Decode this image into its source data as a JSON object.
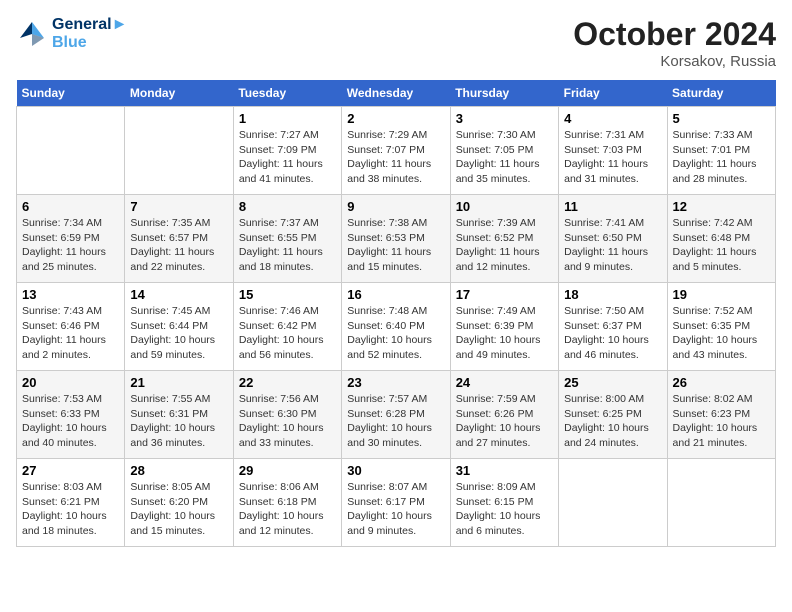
{
  "header": {
    "logo_line1": "General",
    "logo_line2": "Blue",
    "month": "October 2024",
    "location": "Korsakov, Russia"
  },
  "days_of_week": [
    "Sunday",
    "Monday",
    "Tuesday",
    "Wednesday",
    "Thursday",
    "Friday",
    "Saturday"
  ],
  "weeks": [
    [
      {
        "day": "",
        "info": ""
      },
      {
        "day": "",
        "info": ""
      },
      {
        "day": "1",
        "info": "Sunrise: 7:27 AM\nSunset: 7:09 PM\nDaylight: 11 hours and 41 minutes."
      },
      {
        "day": "2",
        "info": "Sunrise: 7:29 AM\nSunset: 7:07 PM\nDaylight: 11 hours and 38 minutes."
      },
      {
        "day": "3",
        "info": "Sunrise: 7:30 AM\nSunset: 7:05 PM\nDaylight: 11 hours and 35 minutes."
      },
      {
        "day": "4",
        "info": "Sunrise: 7:31 AM\nSunset: 7:03 PM\nDaylight: 11 hours and 31 minutes."
      },
      {
        "day": "5",
        "info": "Sunrise: 7:33 AM\nSunset: 7:01 PM\nDaylight: 11 hours and 28 minutes."
      }
    ],
    [
      {
        "day": "6",
        "info": "Sunrise: 7:34 AM\nSunset: 6:59 PM\nDaylight: 11 hours and 25 minutes."
      },
      {
        "day": "7",
        "info": "Sunrise: 7:35 AM\nSunset: 6:57 PM\nDaylight: 11 hours and 22 minutes."
      },
      {
        "day": "8",
        "info": "Sunrise: 7:37 AM\nSunset: 6:55 PM\nDaylight: 11 hours and 18 minutes."
      },
      {
        "day": "9",
        "info": "Sunrise: 7:38 AM\nSunset: 6:53 PM\nDaylight: 11 hours and 15 minutes."
      },
      {
        "day": "10",
        "info": "Sunrise: 7:39 AM\nSunset: 6:52 PM\nDaylight: 11 hours and 12 minutes."
      },
      {
        "day": "11",
        "info": "Sunrise: 7:41 AM\nSunset: 6:50 PM\nDaylight: 11 hours and 9 minutes."
      },
      {
        "day": "12",
        "info": "Sunrise: 7:42 AM\nSunset: 6:48 PM\nDaylight: 11 hours and 5 minutes."
      }
    ],
    [
      {
        "day": "13",
        "info": "Sunrise: 7:43 AM\nSunset: 6:46 PM\nDaylight: 11 hours and 2 minutes."
      },
      {
        "day": "14",
        "info": "Sunrise: 7:45 AM\nSunset: 6:44 PM\nDaylight: 10 hours and 59 minutes."
      },
      {
        "day": "15",
        "info": "Sunrise: 7:46 AM\nSunset: 6:42 PM\nDaylight: 10 hours and 56 minutes."
      },
      {
        "day": "16",
        "info": "Sunrise: 7:48 AM\nSunset: 6:40 PM\nDaylight: 10 hours and 52 minutes."
      },
      {
        "day": "17",
        "info": "Sunrise: 7:49 AM\nSunset: 6:39 PM\nDaylight: 10 hours and 49 minutes."
      },
      {
        "day": "18",
        "info": "Sunrise: 7:50 AM\nSunset: 6:37 PM\nDaylight: 10 hours and 46 minutes."
      },
      {
        "day": "19",
        "info": "Sunrise: 7:52 AM\nSunset: 6:35 PM\nDaylight: 10 hours and 43 minutes."
      }
    ],
    [
      {
        "day": "20",
        "info": "Sunrise: 7:53 AM\nSunset: 6:33 PM\nDaylight: 10 hours and 40 minutes."
      },
      {
        "day": "21",
        "info": "Sunrise: 7:55 AM\nSunset: 6:31 PM\nDaylight: 10 hours and 36 minutes."
      },
      {
        "day": "22",
        "info": "Sunrise: 7:56 AM\nSunset: 6:30 PM\nDaylight: 10 hours and 33 minutes."
      },
      {
        "day": "23",
        "info": "Sunrise: 7:57 AM\nSunset: 6:28 PM\nDaylight: 10 hours and 30 minutes."
      },
      {
        "day": "24",
        "info": "Sunrise: 7:59 AM\nSunset: 6:26 PM\nDaylight: 10 hours and 27 minutes."
      },
      {
        "day": "25",
        "info": "Sunrise: 8:00 AM\nSunset: 6:25 PM\nDaylight: 10 hours and 24 minutes."
      },
      {
        "day": "26",
        "info": "Sunrise: 8:02 AM\nSunset: 6:23 PM\nDaylight: 10 hours and 21 minutes."
      }
    ],
    [
      {
        "day": "27",
        "info": "Sunrise: 8:03 AM\nSunset: 6:21 PM\nDaylight: 10 hours and 18 minutes."
      },
      {
        "day": "28",
        "info": "Sunrise: 8:05 AM\nSunset: 6:20 PM\nDaylight: 10 hours and 15 minutes."
      },
      {
        "day": "29",
        "info": "Sunrise: 8:06 AM\nSunset: 6:18 PM\nDaylight: 10 hours and 12 minutes."
      },
      {
        "day": "30",
        "info": "Sunrise: 8:07 AM\nSunset: 6:17 PM\nDaylight: 10 hours and 9 minutes."
      },
      {
        "day": "31",
        "info": "Sunrise: 8:09 AM\nSunset: 6:15 PM\nDaylight: 10 hours and 6 minutes."
      },
      {
        "day": "",
        "info": ""
      },
      {
        "day": "",
        "info": ""
      }
    ]
  ]
}
